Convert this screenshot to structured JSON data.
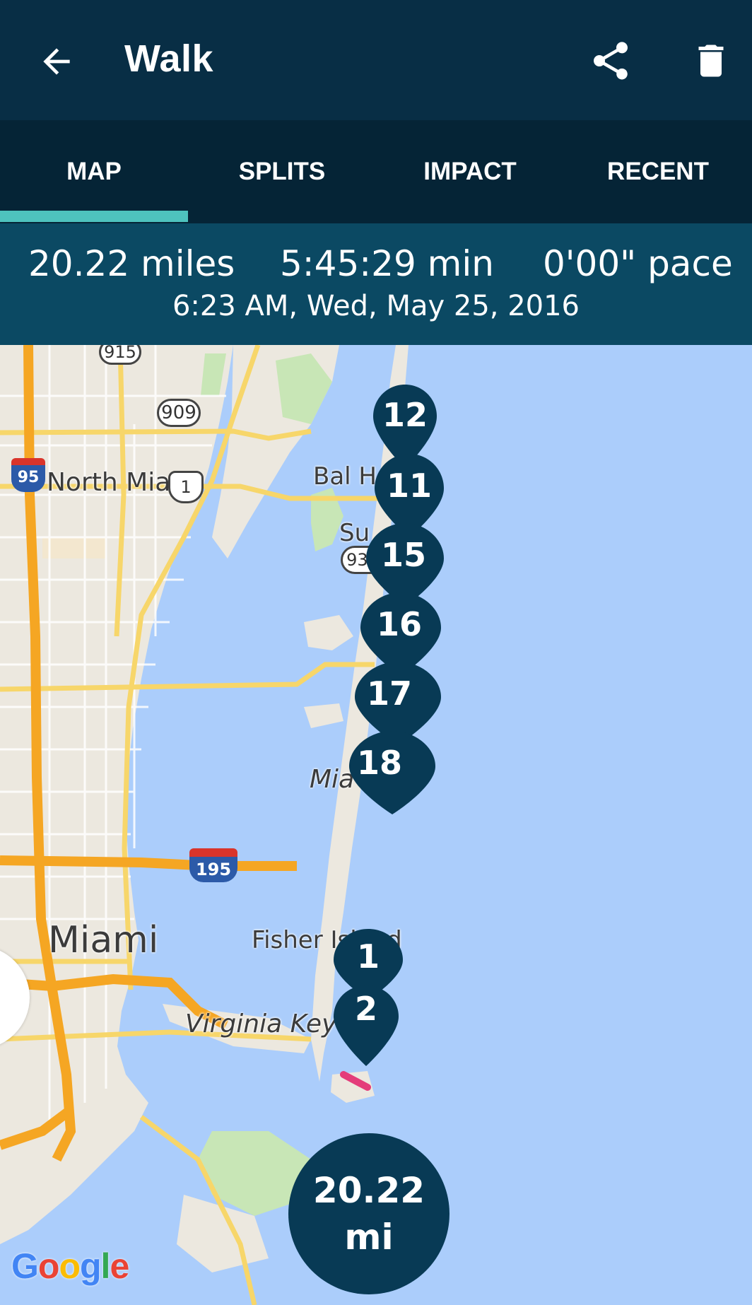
{
  "header": {
    "title": "Walk",
    "back_icon": "arrow-left-icon",
    "share_icon": "share-icon",
    "delete_icon": "trash-icon"
  },
  "tabs": [
    {
      "label": "MAP",
      "active": true
    },
    {
      "label": "SPLITS",
      "active": false
    },
    {
      "label": "IMPACT",
      "active": false
    },
    {
      "label": "RECENT",
      "active": false
    }
  ],
  "summary": {
    "distance": "20.22 miles",
    "duration": "5:45:29 min",
    "pace": "0'00\" pace",
    "datetime": "6:23 AM, Wed, May 25, 2016"
  },
  "map": {
    "places": [
      {
        "name": "North Miami"
      },
      {
        "name": "Bal Harbour",
        "visible": "Bal H"
      },
      {
        "name": "Surfside",
        "visible": "Su"
      },
      {
        "name": "Miami Beach",
        "visible": "Mia"
      },
      {
        "name": "Miami"
      },
      {
        "name": "Fisher Island"
      },
      {
        "name": "Virginia Key"
      }
    ],
    "road_shields": [
      "915",
      "909",
      "95",
      "1",
      "934",
      "195"
    ],
    "markers": [
      "12",
      "11",
      "15",
      "16",
      "17",
      "18",
      "1",
      "2"
    ],
    "total_marker": {
      "value": "20.22",
      "unit": "mi"
    },
    "attribution": "Google"
  },
  "colors": {
    "header_bg": "#082e45",
    "tabs_bg": "#052436",
    "tab_indicator": "#4ec3be",
    "stats_bg": "#0b4963",
    "marker": "#083a55",
    "water": "#abcdfb",
    "land": "#ece8df",
    "route": "#e43c7a"
  }
}
